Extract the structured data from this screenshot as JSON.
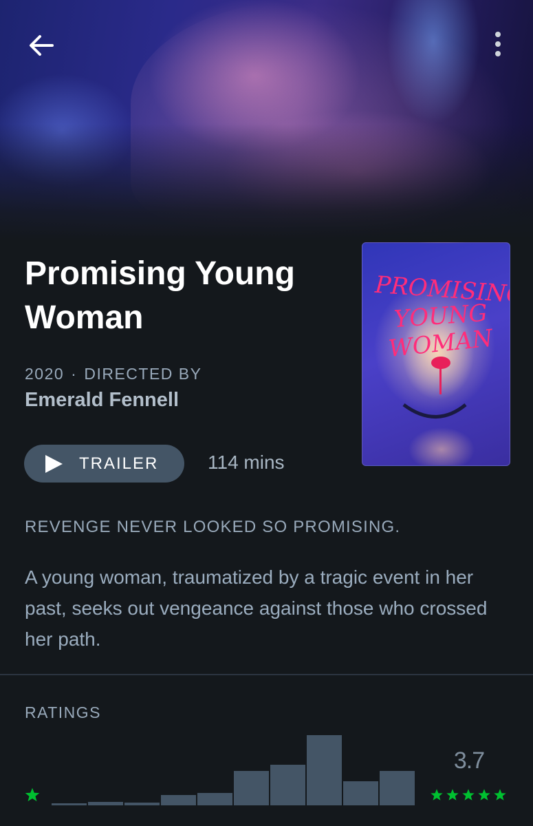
{
  "film": {
    "title": "Promising Young Woman",
    "year": "2020",
    "directed_by_label": "DIRECTED BY",
    "separator": "·",
    "director": "Emerald Fennell",
    "trailer_label": "TRAILER",
    "runtime": "114 mins",
    "tagline": "REVENGE NEVER LOOKED SO PROMISING.",
    "synopsis": "A young woman, traumatized by a tragic event in her past, seeks out vengeance against those who crossed her path."
  },
  "poster": {
    "title_art": "Promising Young Woman",
    "art_color": "#ff2d7a"
  },
  "ratings": {
    "label": "RATINGS",
    "average": "3.7",
    "distribution": [
      0.02,
      0.05,
      0.04,
      0.15,
      0.18,
      0.49,
      0.58,
      1.0,
      0.34,
      0.49
    ],
    "bar_color": "#445566",
    "star_color": "#00c030"
  },
  "icons": {
    "back": "arrow-left-icon",
    "more": "more-vertical-icon",
    "play": "play-icon",
    "star": "star-icon"
  },
  "colors": {
    "background": "#14181c",
    "button": "#445566",
    "muted_text": "#99aabb"
  }
}
